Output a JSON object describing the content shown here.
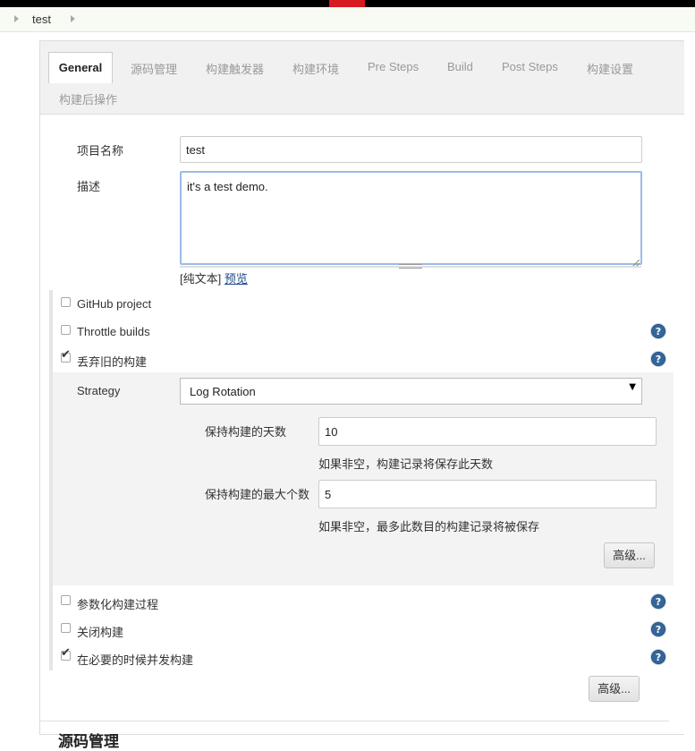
{
  "breadcrumb": {
    "item": "test"
  },
  "tabs": [
    {
      "label": "General"
    },
    {
      "label": "源码管理"
    },
    {
      "label": "构建触发器"
    },
    {
      "label": "构建环境"
    },
    {
      "label": "Pre Steps"
    },
    {
      "label": "Build"
    },
    {
      "label": "Post Steps"
    },
    {
      "label": "构建设置"
    },
    {
      "label": "构建后操作"
    }
  ],
  "form": {
    "project_name_label": "项目名称",
    "project_name_value": "test",
    "description_label": "描述",
    "description_value": "it's a test demo.",
    "plain_text_prefix": "[纯文本]",
    "preview_link": "预览"
  },
  "options": {
    "github_project": "GitHub project",
    "throttle_builds": "Throttle builds",
    "discard_old_builds": "丢弃旧的构建",
    "parameterized": "参数化构建过程",
    "disable_build": "关闭构建",
    "concurrent_build": "在必要的时候并发构建"
  },
  "discard": {
    "strategy_label": "Strategy",
    "strategy_value": "Log Rotation",
    "days_label": "保持构建的天数",
    "days_value": "10",
    "days_hint": "如果非空，构建记录将保存此天数",
    "max_label": "保持构建的最大个数",
    "max_value": "5",
    "max_hint": "如果非空，最多此数目的构建记录将被保存",
    "advanced_button": "高级..."
  },
  "general_advanced_button": "高级...",
  "next_section_heading": "源码管理",
  "help_glyph": "?",
  "check_glyph": "✔",
  "dropdown_arrow": "▼",
  "colors": {
    "accent": "#d71920",
    "help": "#34669a",
    "link": "#204a87"
  }
}
